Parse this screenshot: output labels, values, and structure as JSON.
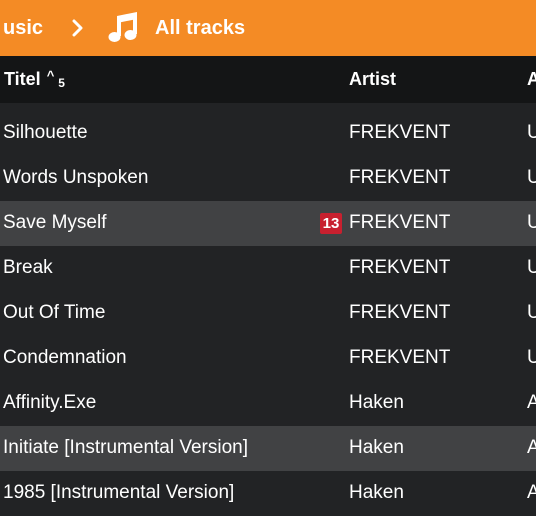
{
  "breadcrumb": {
    "parent_label": "usic",
    "current_label": "All tracks",
    "note_icon": "music-note-icon",
    "chevron_icon": "chevron-right-icon",
    "accent_color": "#f48b25"
  },
  "table": {
    "headers": {
      "title": "Titel",
      "sort_caret": "^",
      "sort_rank": "5",
      "artist": "Artist",
      "third": "A"
    },
    "rows": [
      {
        "title": "Silhouette",
        "artist": "FREKVENT",
        "third": "U",
        "highlight": false,
        "badge": ""
      },
      {
        "title": "Words Unspoken",
        "artist": "FREKVENT",
        "third": "U",
        "highlight": false,
        "badge": ""
      },
      {
        "title": "Save Myself",
        "artist": "FREKVENT",
        "third": "U",
        "highlight": true,
        "badge": "13"
      },
      {
        "title": "Break",
        "artist": "FREKVENT",
        "third": "U",
        "highlight": false,
        "badge": ""
      },
      {
        "title": "Out Of Time",
        "artist": "FREKVENT",
        "third": "U",
        "highlight": false,
        "badge": ""
      },
      {
        "title": "Condemnation",
        "artist": "FREKVENT",
        "third": "U",
        "highlight": false,
        "badge": ""
      },
      {
        "title": "Affinity.Exe",
        "artist": "Haken",
        "third": "A",
        "highlight": false,
        "badge": ""
      },
      {
        "title": "Initiate [Instrumental Version]",
        "artist": "Haken",
        "third": "A",
        "highlight": true,
        "badge": ""
      },
      {
        "title": "1985 [Instrumental Version]",
        "artist": "Haken",
        "third": "A",
        "highlight": false,
        "badge": ""
      }
    ]
  }
}
